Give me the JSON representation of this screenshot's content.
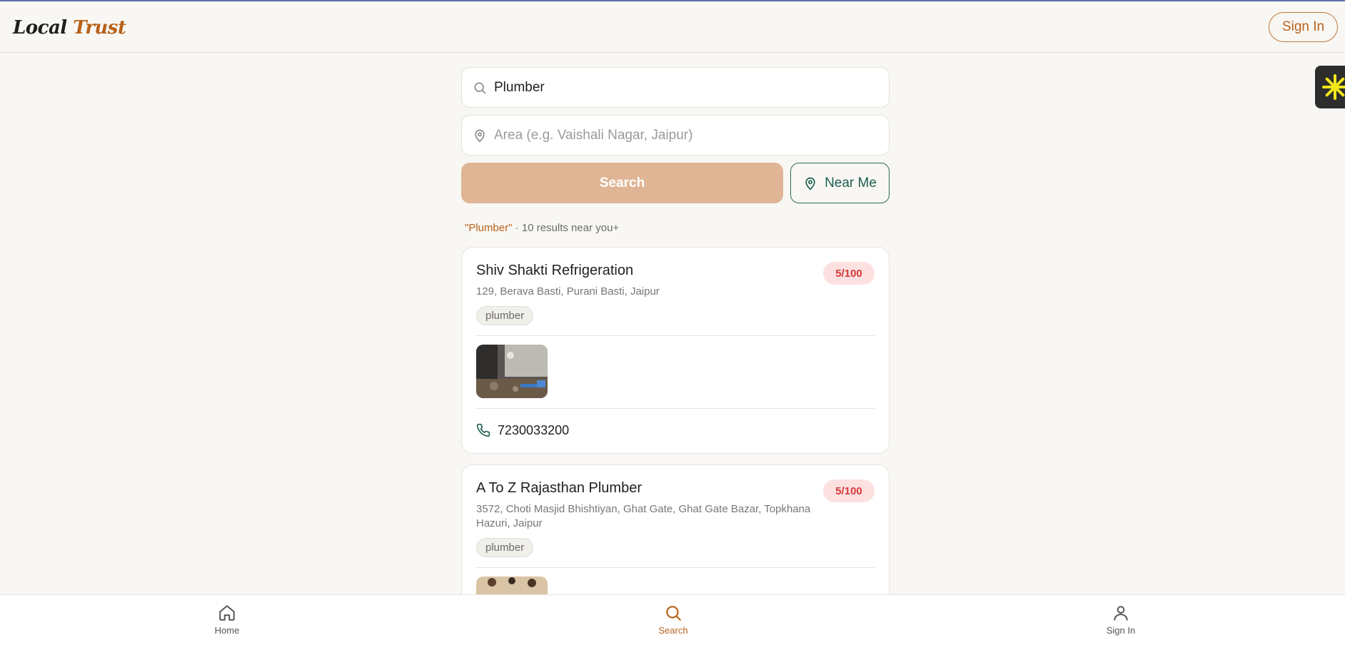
{
  "brand": {
    "word1": "Local",
    "word2": "Trust"
  },
  "header": {
    "signin_label": "Sign In"
  },
  "search": {
    "query_value": "Plumber",
    "query_placeholder": "",
    "area_value": "",
    "area_placeholder": "Area (e.g. Vaishali Nagar, Jaipur)",
    "search_label": "Search",
    "near_me_label": "Near Me"
  },
  "summary": {
    "query": "\"Plumber\"",
    "text": " · 10 results near you+"
  },
  "results": [
    {
      "name": "Shiv Shakti Refrigeration",
      "address": "129, Berava Basti, Purani Basti, Jaipur",
      "tag": "plumber",
      "score": "5/100",
      "phone": "7230033200"
    },
    {
      "name": "A To Z Rajasthan Plumber",
      "address": "3572, Choti Masjid Bhishtiyan, Ghat Gate, Ghat Gate Bazar, Topkhana Hazuri, Jaipur",
      "tag": "plumber",
      "score": "5/100"
    }
  ],
  "bottom_nav": {
    "home_label": "Home",
    "search_label": "Search",
    "signin_label": "Sign In",
    "active": "search"
  },
  "colors": {
    "accent": "#b8621a",
    "search_button": "#dfb595",
    "near_me": "#1e5e52",
    "score_bg": "#fde1e1",
    "score_text": "#d63a3a"
  },
  "icons": [
    "search-icon",
    "location-pin-icon",
    "phone-icon",
    "home-icon",
    "user-icon",
    "asterisk-icon"
  ]
}
